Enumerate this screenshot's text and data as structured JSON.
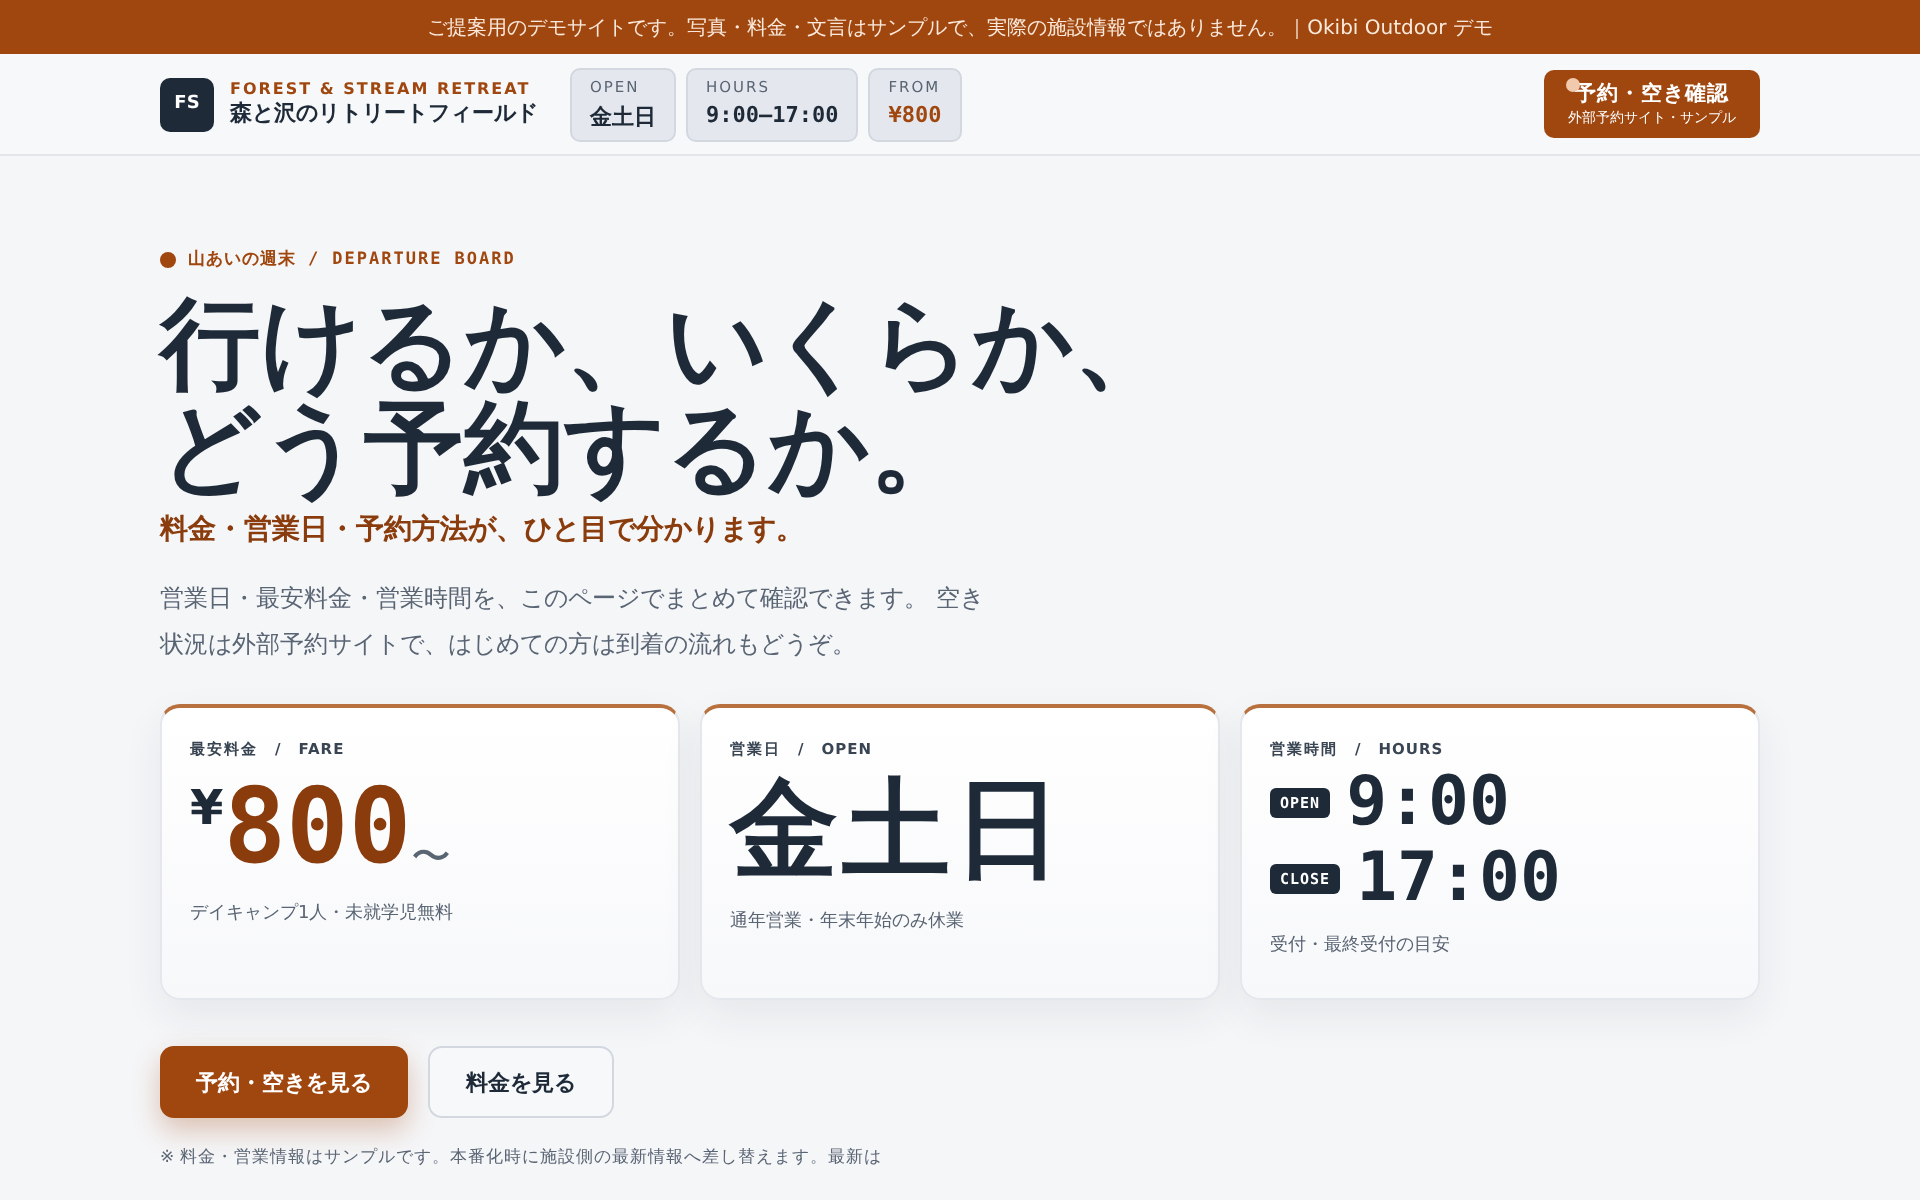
{
  "banner": "ご提案用のデモサイトです。写真・料金・文言はサンプルで、実際の施設情報ではありません。｜Okibi Outdoor デモ",
  "header": {
    "logo": "FS",
    "brand_en": "FOREST & STREAM RETREAT",
    "brand_ja": "森と沢のリトリートフィールド",
    "chips": [
      {
        "label": "OPEN",
        "value": "金土日",
        "kind": "plain"
      },
      {
        "label": "HOURS",
        "value": "9:00–17:00",
        "kind": "mono"
      },
      {
        "label": "FROM",
        "value": "¥800",
        "kind": "price"
      }
    ],
    "cta": {
      "title": "予約・空き確認",
      "sub": "外部予約サイト・サンプル"
    }
  },
  "hero": {
    "eyebrow_ja": "山あいの週末",
    "eyebrow_sep": "/",
    "eyebrow_en": "DEPARTURE BOARD",
    "title_lines": [
      "行けるか、いくらか、",
      "どう予約するか。"
    ],
    "subtitle": "料金・営業日・予約方法が、ひと目で分かります。",
    "lead": "営業日・最安料金・営業時間を、このページでまとめて確認できます。 空き状況は外部予約サイトで、はじめての方は到着の流れもどうぞ。"
  },
  "cards": [
    {
      "kind": "fare",
      "label": "最安料金　/　FARE",
      "currency": "¥",
      "value": "800",
      "suffix": "〜",
      "note": "デイキャンプ1人・未就学児無料"
    },
    {
      "kind": "days",
      "label": "営業日　/　OPEN",
      "value": "金土日",
      "note": "通年営業・年末年始のみ休業"
    },
    {
      "kind": "hours",
      "label": "営業時間　/　HOURS",
      "rows": [
        {
          "tag": "OPEN",
          "time": "9:00"
        },
        {
          "tag": "CLOSE",
          "time": "17:00"
        }
      ],
      "note": "受付・最終受付の目安"
    }
  ],
  "buttons": [
    {
      "label": "予約・空きを見る",
      "kind": "primary"
    },
    {
      "label": "料金を見る",
      "kind": "secondary"
    }
  ],
  "footnote": "※ 料金・営業情報はサンプルです。本番化時に施設側の最新情報へ差し替えます。最新は"
}
